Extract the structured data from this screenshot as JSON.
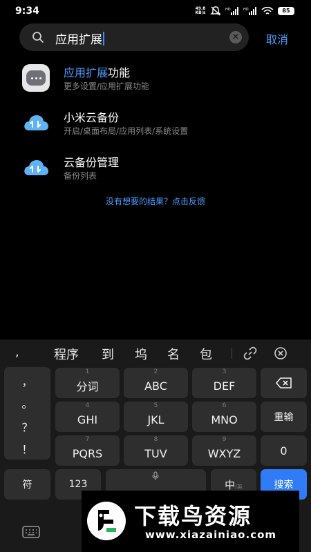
{
  "status_bar": {
    "time": "9:34",
    "net_speed_value": "49.8",
    "net_speed_unit": "KB/s",
    "signal_1_label": "HD",
    "signal_2_label": "HD",
    "battery": "85"
  },
  "search": {
    "query": "应用扩展",
    "clear_icon": "close-circle-icon",
    "cancel_label": "取消"
  },
  "results": [
    {
      "title_highlight": "应用扩展",
      "title_rest": "功能",
      "subtitle": "更多设置/应用扩展功能",
      "icon": "more-dots-icon"
    },
    {
      "title_highlight": "",
      "title_rest": "小米云备份",
      "subtitle": "开启/桌面布局/应用列表/系统设置",
      "icon": "cloud-sync-icon"
    },
    {
      "title_highlight": "",
      "title_rest": "云备份管理",
      "subtitle": "备份列表",
      "icon": "cloud-sync-icon"
    }
  ],
  "feedback_link": "没有想要的结果？点击反馈",
  "keyboard": {
    "candidates": [
      ",",
      "程序",
      "到",
      "坞",
      "名",
      "包"
    ],
    "punct_column": [
      "，",
      "。",
      "？",
      "！"
    ],
    "rows": [
      [
        {
          "sub": "1",
          "label": "分词"
        },
        {
          "sub": "2",
          "label": "ABC"
        },
        {
          "sub": "3",
          "label": "DEF"
        }
      ],
      [
        {
          "sub": "4",
          "label": "GHI"
        },
        {
          "sub": "5",
          "label": "JKL"
        },
        {
          "sub": "6",
          "label": "MNO"
        }
      ],
      [
        {
          "sub": "7",
          "label": "PQRS"
        },
        {
          "sub": "8",
          "label": "TUV"
        },
        {
          "sub": "9",
          "label": "WXYZ"
        }
      ]
    ],
    "right_keys": {
      "retype": "重输",
      "zero": "0"
    },
    "bottom": {
      "symbols": "符",
      "numbers": "123",
      "lang": "中",
      "lang_sub": "/英",
      "search": "搜索"
    }
  },
  "watermark": {
    "title": "下载鸟资源",
    "url": "www.xiazainiao.com"
  },
  "colors": {
    "accent": "#4a9bff",
    "search_key": "#2f7cf6",
    "key_bg": "#2e2e2e"
  }
}
